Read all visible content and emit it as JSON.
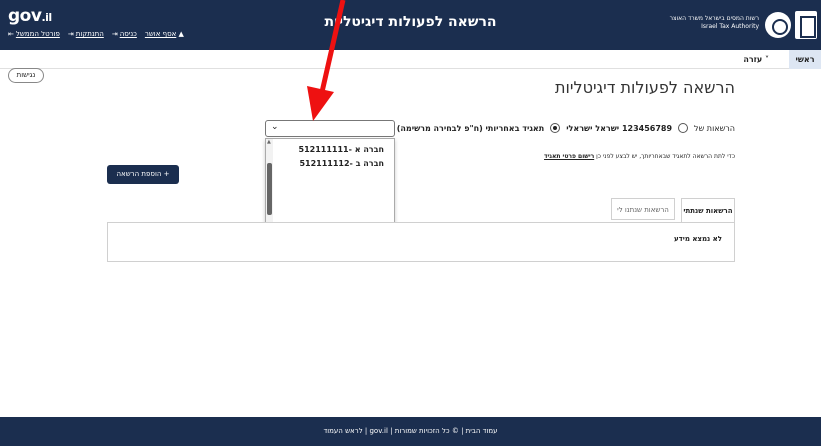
{
  "header": {
    "logo_text": "gov",
    "logo_suffix": ".il",
    "title": "הרשאה לפעולות דיגיטליות",
    "authority_he": "רשות המסים בישראל משרד האוצר",
    "authority_en": "Israel Tax Authority",
    "user_links": {
      "user": "אסף אושר",
      "login": "כניסה",
      "logout": "התנתקות",
      "gov_site": "פורטל הממשל"
    }
  },
  "nav": {
    "home": "ראשי",
    "help": "עזרה ˅"
  },
  "accessibility_label": "נגישות",
  "page": {
    "title": "הרשאה לפעולות דיגיטליות",
    "permissions_of": "הרשאות של",
    "person_id": "123456789 ישראל ישראלי",
    "agent_option": "תאגיד באחריותי (ח\"פ לבחירה מרשימה)",
    "agent_note_text": "כדי לתת הרשאה לתאגיד שבאחריותך, יש לבצע לפני כן",
    "agent_note_link": "רישום פרטי תאגיד",
    "add_permission": "הוספת הרשאה  +"
  },
  "dropdown": {
    "items": [
      "512111111- חברה א",
      "512111112- חברה ב"
    ]
  },
  "tabs": {
    "given": "הרשאות שנתתי",
    "received": "הרשאות שנתנו לי"
  },
  "results": {
    "empty": "לא נמצא מידע"
  },
  "footer": {
    "text": "עמוד הבית  |  © כל הזכויות שמורות  |  gov.il  |  לראש העמוד"
  },
  "colors": {
    "header_bg": "#1b2e4f",
    "arrow": "#ee1111"
  }
}
